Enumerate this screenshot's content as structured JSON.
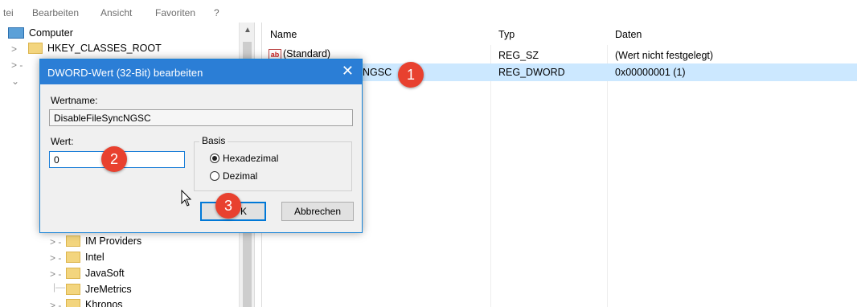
{
  "menu": [
    "tei",
    "Bearbeiten",
    "Ansicht",
    "Favoriten",
    "?"
  ],
  "tree": {
    "top": [
      {
        "label": "Computer",
        "expander": ""
      },
      {
        "label": "HKEY_CLASSES_ROOT",
        "expander": ">"
      }
    ],
    "bottom": [
      {
        "label": "IM Providers",
        "expander": "> -"
      },
      {
        "label": "Intel",
        "expander": "> -"
      },
      {
        "label": "JavaSoft",
        "expander": "> -"
      },
      {
        "label": "JreMetrics",
        "expander": ""
      },
      {
        "label": "Khronos",
        "expander": "> -"
      }
    ]
  },
  "list": {
    "headers": {
      "name": "Name",
      "type": "Typ",
      "data": "Daten"
    },
    "rows": [
      {
        "icon": "ab",
        "name": "(Standard)",
        "type": "REG_SZ",
        "data": "(Wert nicht festgelegt)"
      },
      {
        "name": "NGSC",
        "type": "REG_DWORD",
        "data": "0x00000001 (1)"
      }
    ]
  },
  "dialog": {
    "title": "DWORD-Wert (32-Bit) bearbeiten",
    "close": "✕",
    "name_label": "Wertname:",
    "name_value": "DisableFileSyncNGSC",
    "value_label": "Wert:",
    "value_value": "0",
    "base_label": "Basis",
    "hex_label": "Hexadezimal",
    "dec_label": "Dezimal",
    "ok_label": "K",
    "cancel_label": "Abbrechen"
  },
  "badges": [
    "1",
    "2",
    "3"
  ],
  "colors": {
    "accent": "#2b7ed6",
    "selection": "#cce8ff",
    "badge": "#e8412f"
  }
}
